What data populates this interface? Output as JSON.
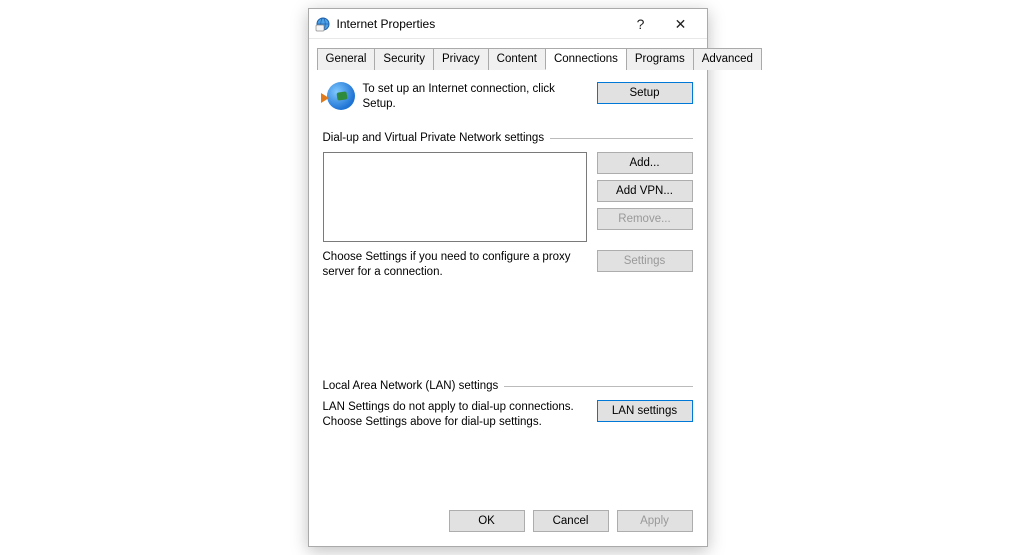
{
  "titlebar": {
    "title": "Internet Properties",
    "help": "?",
    "close": "✕"
  },
  "tabs": {
    "items": [
      {
        "label": "General"
      },
      {
        "label": "Security"
      },
      {
        "label": "Privacy"
      },
      {
        "label": "Content"
      },
      {
        "label": "Connections"
      },
      {
        "label": "Programs"
      },
      {
        "label": "Advanced"
      }
    ],
    "active_index": 4
  },
  "setup": {
    "text": "To set up an Internet connection, click Setup.",
    "button": "Setup"
  },
  "dialup": {
    "group_label": "Dial-up and Virtual Private Network settings",
    "add_button": "Add...",
    "add_vpn_button": "Add VPN...",
    "remove_button": "Remove...",
    "settings_text": "Choose Settings if you need to configure a proxy server for a connection.",
    "settings_button": "Settings"
  },
  "lan": {
    "group_label": "Local Area Network (LAN) settings",
    "text": "LAN Settings do not apply to dial-up connections. Choose Settings above for dial-up settings.",
    "button": "LAN settings"
  },
  "footer": {
    "ok": "OK",
    "cancel": "Cancel",
    "apply": "Apply"
  }
}
